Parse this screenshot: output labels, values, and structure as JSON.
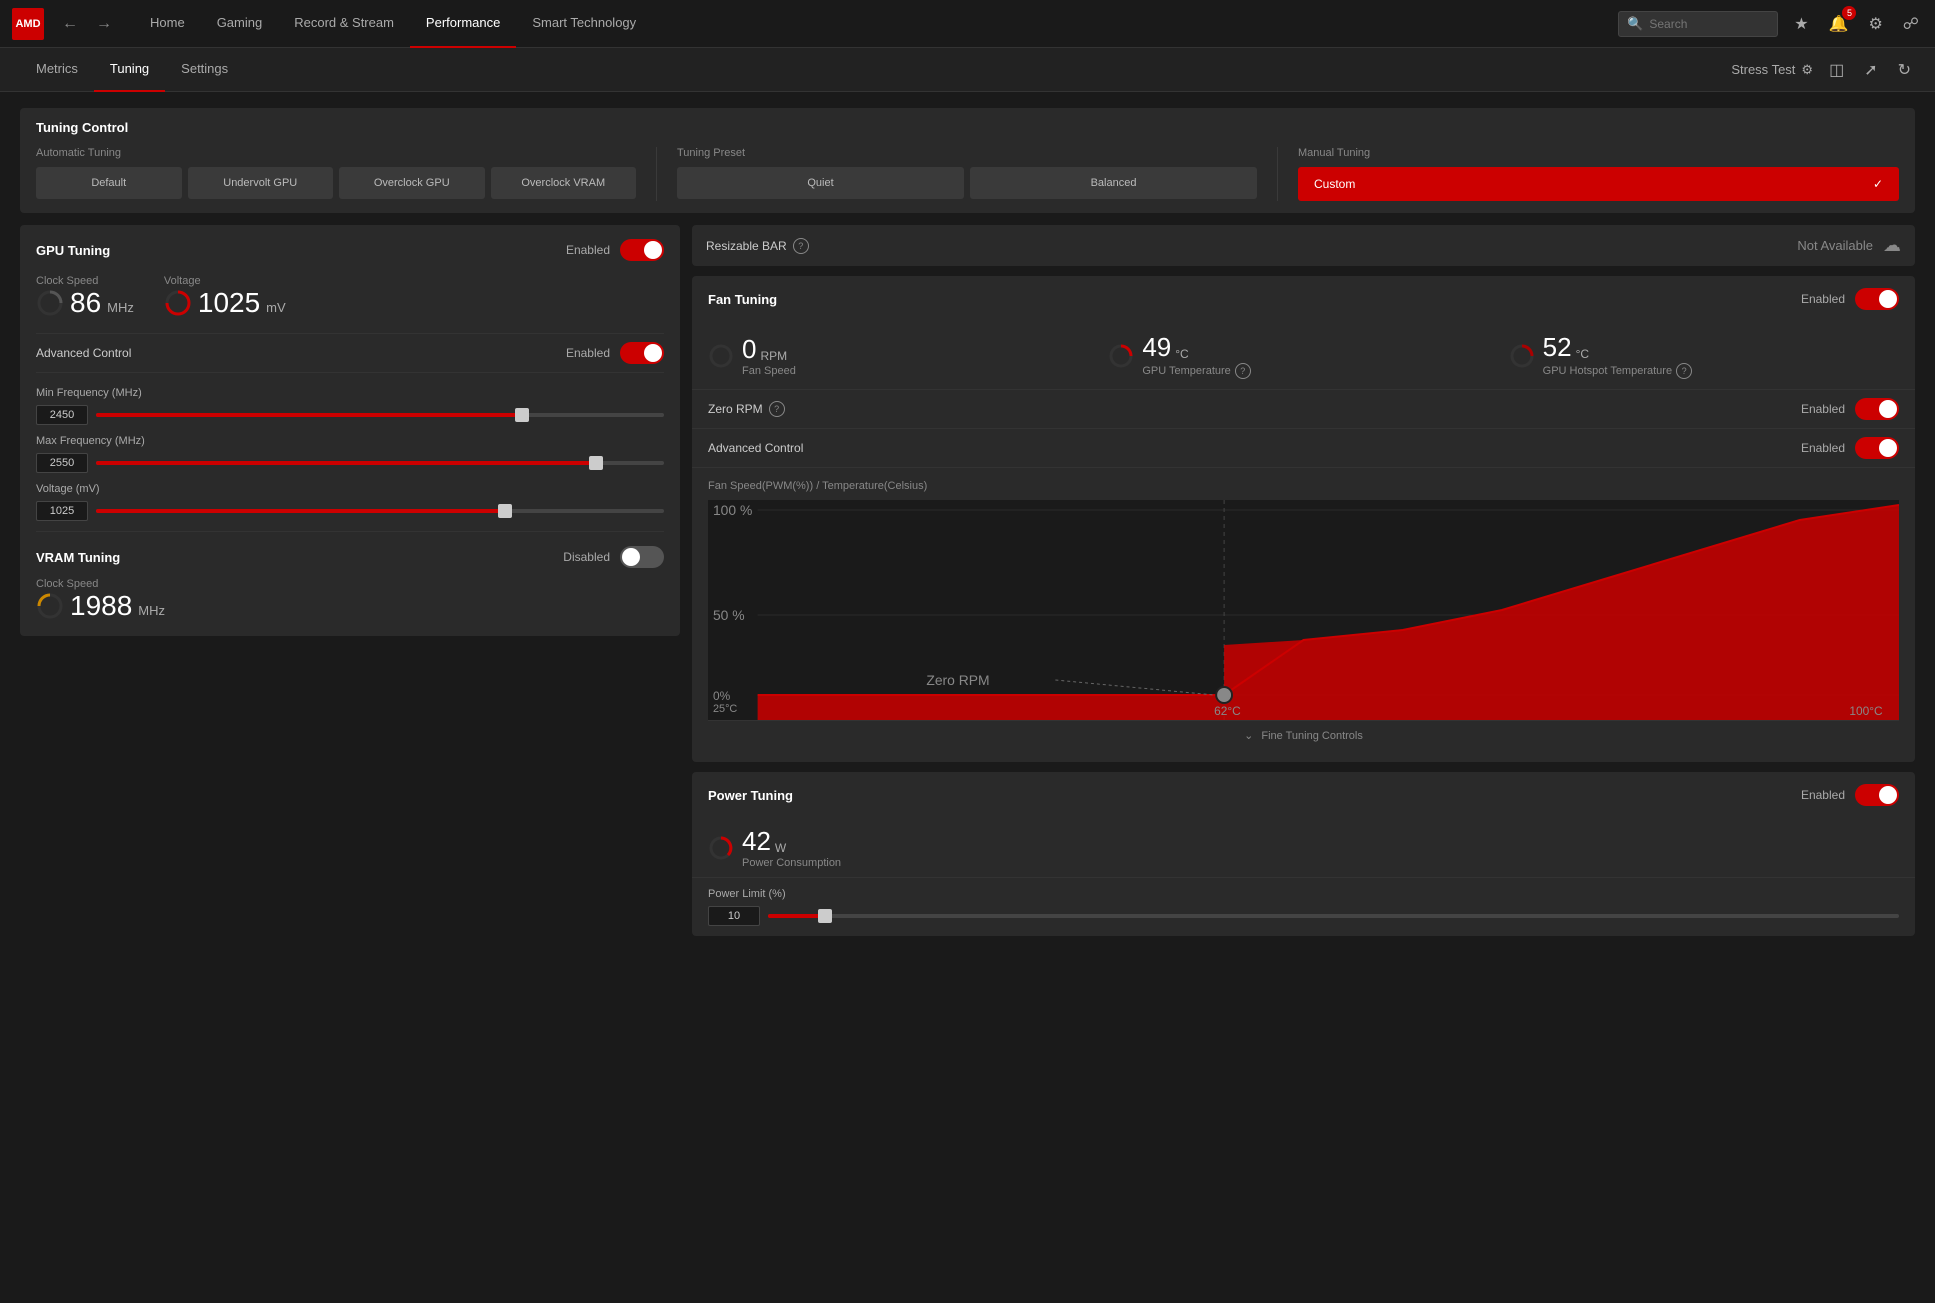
{
  "app": {
    "logo": "AMD",
    "nav_items": [
      {
        "label": "Home",
        "active": false
      },
      {
        "label": "Gaming",
        "active": false
      },
      {
        "label": "Record & Stream",
        "active": false
      },
      {
        "label": "Performance",
        "active": true
      },
      {
        "label": "Smart Technology",
        "active": false
      }
    ],
    "search_placeholder": "Search",
    "sub_nav": [
      {
        "label": "Metrics",
        "active": false
      },
      {
        "label": "Tuning",
        "active": true
      },
      {
        "label": "Settings",
        "active": false
      }
    ],
    "stress_test": "Stress Test"
  },
  "tuning_control": {
    "title": "Tuning Control",
    "automatic_tuning_label": "Automatic Tuning",
    "auto_buttons": [
      "Default",
      "Undervolt GPU",
      "Overclock GPU",
      "Overclock VRAM"
    ],
    "tuning_preset_label": "Tuning Preset",
    "preset_buttons": [
      "Quiet",
      "Balanced"
    ],
    "manual_tuning_label": "Manual Tuning",
    "manual_button_label": "Custom"
  },
  "gpu_tuning": {
    "title": "GPU Tuning",
    "enabled_label": "Enabled",
    "enabled": true,
    "clock_speed_label": "Clock Speed",
    "clock_speed_value": "86",
    "clock_speed_unit": "MHz",
    "voltage_label": "Voltage",
    "voltage_value": "1025",
    "voltage_unit": "mV",
    "advanced_control_label": "Advanced Control",
    "advanced_enabled_label": "Enabled",
    "advanced_enabled": true,
    "min_freq_label": "Min Frequency (MHz)",
    "min_freq_value": "2450",
    "min_freq_pct": 75,
    "max_freq_label": "Max Frequency (MHz)",
    "max_freq_value": "2550",
    "max_freq_pct": 88,
    "voltage_mv_label": "Voltage (mV)",
    "voltage_mv_value": "1025",
    "voltage_mv_pct": 72
  },
  "vram_tuning": {
    "title": "VRAM Tuning",
    "disabled_label": "Disabled",
    "enabled": false,
    "clock_speed_label": "Clock Speed",
    "clock_speed_value": "1988",
    "clock_speed_unit": "MHz"
  },
  "resizable_bar": {
    "label": "Resizable BAR",
    "status": "Not Available"
  },
  "fan_tuning": {
    "title": "Fan Tuning",
    "enabled_label": "Enabled",
    "enabled": true,
    "fan_speed_label": "Fan Speed",
    "fan_speed_value": "0",
    "fan_speed_unit": "RPM",
    "gpu_temp_label": "GPU Temperature",
    "gpu_temp_value": "49",
    "gpu_temp_unit": "°C",
    "gpu_hotspot_label": "GPU Hotspot Temperature",
    "gpu_hotspot_value": "52",
    "gpu_hotspot_unit": "°C",
    "zero_rpm_label": "Zero RPM",
    "zero_rpm_enabled_label": "Enabled",
    "zero_rpm_enabled": true,
    "advanced_control_label": "Advanced Control",
    "advanced_enabled_label": "Enabled",
    "advanced_enabled": true,
    "chart_title": "Fan Speed(PWM(%)) / Temperature(Celsius)",
    "chart_y_labels": [
      "100 %",
      "50 %",
      "0%, 25°C"
    ],
    "chart_x_labels": [
      "62°C",
      "100°C"
    ],
    "zero_rpm_chart_label": "Zero RPM",
    "fine_tuning_label": "Fine Tuning Controls"
  },
  "power_tuning": {
    "title": "Power Tuning",
    "enabled_label": "Enabled",
    "enabled": true,
    "consumption_label": "Power Consumption",
    "consumption_value": "42",
    "consumption_unit": "W",
    "limit_label": "Power Limit (%)",
    "limit_value": "10",
    "limit_pct": 5
  }
}
